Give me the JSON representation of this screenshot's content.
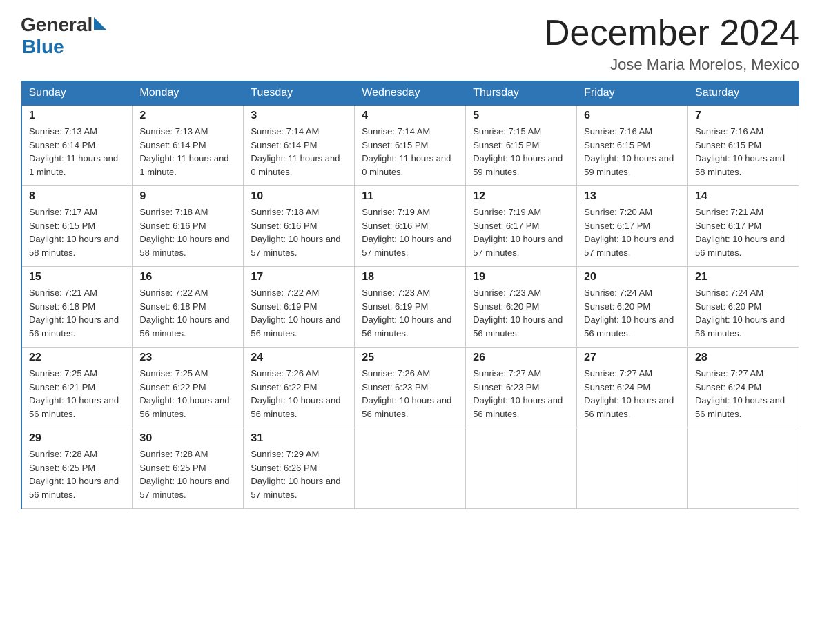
{
  "header": {
    "logo_general": "General",
    "logo_blue": "Blue",
    "month_title": "December 2024",
    "location": "Jose Maria Morelos, Mexico"
  },
  "days_of_week": [
    "Sunday",
    "Monday",
    "Tuesday",
    "Wednesday",
    "Thursday",
    "Friday",
    "Saturday"
  ],
  "weeks": [
    [
      {
        "day": "1",
        "sunrise": "7:13 AM",
        "sunset": "6:14 PM",
        "daylight": "11 hours and 1 minute."
      },
      {
        "day": "2",
        "sunrise": "7:13 AM",
        "sunset": "6:14 PM",
        "daylight": "11 hours and 1 minute."
      },
      {
        "day": "3",
        "sunrise": "7:14 AM",
        "sunset": "6:14 PM",
        "daylight": "11 hours and 0 minutes."
      },
      {
        "day": "4",
        "sunrise": "7:14 AM",
        "sunset": "6:15 PM",
        "daylight": "11 hours and 0 minutes."
      },
      {
        "day": "5",
        "sunrise": "7:15 AM",
        "sunset": "6:15 PM",
        "daylight": "10 hours and 59 minutes."
      },
      {
        "day": "6",
        "sunrise": "7:16 AM",
        "sunset": "6:15 PM",
        "daylight": "10 hours and 59 minutes."
      },
      {
        "day": "7",
        "sunrise": "7:16 AM",
        "sunset": "6:15 PM",
        "daylight": "10 hours and 58 minutes."
      }
    ],
    [
      {
        "day": "8",
        "sunrise": "7:17 AM",
        "sunset": "6:15 PM",
        "daylight": "10 hours and 58 minutes."
      },
      {
        "day": "9",
        "sunrise": "7:18 AM",
        "sunset": "6:16 PM",
        "daylight": "10 hours and 58 minutes."
      },
      {
        "day": "10",
        "sunrise": "7:18 AM",
        "sunset": "6:16 PM",
        "daylight": "10 hours and 57 minutes."
      },
      {
        "day": "11",
        "sunrise": "7:19 AM",
        "sunset": "6:16 PM",
        "daylight": "10 hours and 57 minutes."
      },
      {
        "day": "12",
        "sunrise": "7:19 AM",
        "sunset": "6:17 PM",
        "daylight": "10 hours and 57 minutes."
      },
      {
        "day": "13",
        "sunrise": "7:20 AM",
        "sunset": "6:17 PM",
        "daylight": "10 hours and 57 minutes."
      },
      {
        "day": "14",
        "sunrise": "7:21 AM",
        "sunset": "6:17 PM",
        "daylight": "10 hours and 56 minutes."
      }
    ],
    [
      {
        "day": "15",
        "sunrise": "7:21 AM",
        "sunset": "6:18 PM",
        "daylight": "10 hours and 56 minutes."
      },
      {
        "day": "16",
        "sunrise": "7:22 AM",
        "sunset": "6:18 PM",
        "daylight": "10 hours and 56 minutes."
      },
      {
        "day": "17",
        "sunrise": "7:22 AM",
        "sunset": "6:19 PM",
        "daylight": "10 hours and 56 minutes."
      },
      {
        "day": "18",
        "sunrise": "7:23 AM",
        "sunset": "6:19 PM",
        "daylight": "10 hours and 56 minutes."
      },
      {
        "day": "19",
        "sunrise": "7:23 AM",
        "sunset": "6:20 PM",
        "daylight": "10 hours and 56 minutes."
      },
      {
        "day": "20",
        "sunrise": "7:24 AM",
        "sunset": "6:20 PM",
        "daylight": "10 hours and 56 minutes."
      },
      {
        "day": "21",
        "sunrise": "7:24 AM",
        "sunset": "6:20 PM",
        "daylight": "10 hours and 56 minutes."
      }
    ],
    [
      {
        "day": "22",
        "sunrise": "7:25 AM",
        "sunset": "6:21 PM",
        "daylight": "10 hours and 56 minutes."
      },
      {
        "day": "23",
        "sunrise": "7:25 AM",
        "sunset": "6:22 PM",
        "daylight": "10 hours and 56 minutes."
      },
      {
        "day": "24",
        "sunrise": "7:26 AM",
        "sunset": "6:22 PM",
        "daylight": "10 hours and 56 minutes."
      },
      {
        "day": "25",
        "sunrise": "7:26 AM",
        "sunset": "6:23 PM",
        "daylight": "10 hours and 56 minutes."
      },
      {
        "day": "26",
        "sunrise": "7:27 AM",
        "sunset": "6:23 PM",
        "daylight": "10 hours and 56 minutes."
      },
      {
        "day": "27",
        "sunrise": "7:27 AM",
        "sunset": "6:24 PM",
        "daylight": "10 hours and 56 minutes."
      },
      {
        "day": "28",
        "sunrise": "7:27 AM",
        "sunset": "6:24 PM",
        "daylight": "10 hours and 56 minutes."
      }
    ],
    [
      {
        "day": "29",
        "sunrise": "7:28 AM",
        "sunset": "6:25 PM",
        "daylight": "10 hours and 56 minutes."
      },
      {
        "day": "30",
        "sunrise": "7:28 AM",
        "sunset": "6:25 PM",
        "daylight": "10 hours and 57 minutes."
      },
      {
        "day": "31",
        "sunrise": "7:29 AM",
        "sunset": "6:26 PM",
        "daylight": "10 hours and 57 minutes."
      },
      null,
      null,
      null,
      null
    ]
  ]
}
